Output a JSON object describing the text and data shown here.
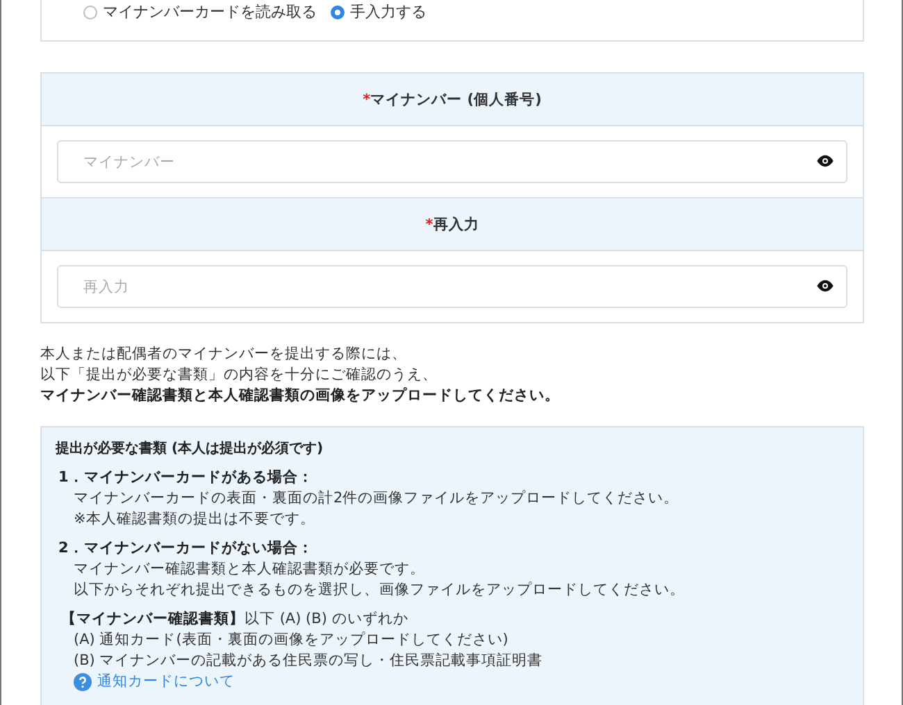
{
  "read_mode_options": [
    {
      "label": "マイナンバーカードを読み取る",
      "selected": false
    },
    {
      "label": "手入力する",
      "selected": true
    }
  ],
  "fields": [
    {
      "required_mark": "*",
      "label": "マイナンバー (個人番号)",
      "placeholder": "マイナンバー"
    },
    {
      "required_mark": "*",
      "label": "再入力",
      "placeholder": "再入力"
    }
  ],
  "notice": {
    "lines": [
      "本人または配偶者のマイナンバーを提出する際には、",
      "以下「提出が必要な書類」の内容を十分にご確認のうえ、"
    ],
    "emphasis": "マイナンバー確認書類と本人確認書類の画像をアップロードしてください。"
  },
  "requirements": {
    "title": "提出が必要な書類 (本人は提出が必須です)",
    "cases": [
      {
        "heading": "1．マイナンバーカードがある場合：",
        "lines": [
          "マイナンバーカードの表面・裏面の計2件の画像ファイルをアップロードしてください。",
          "※本人確認書類の提出は不要です。"
        ]
      },
      {
        "heading": "2．マイナンバーカードがない場合：",
        "lines": [
          "マイナンバー確認書類と本人確認書類が必要です。",
          "以下からそれぞれ提出できるものを選択し、画像ファイルをアップロードしてください。"
        ]
      }
    ],
    "doc_group": {
      "heading": "【マイナンバー確認書類】",
      "qualifier": "以下 (A) (B) のいずれか",
      "options": [
        "(A) 通知カード(表面・裏面の画像をアップロードしてください)",
        "(B) マイナンバーの記載がある住民票の写し・住民票記載事項証明書"
      ],
      "link": "通知カードについて"
    }
  }
}
